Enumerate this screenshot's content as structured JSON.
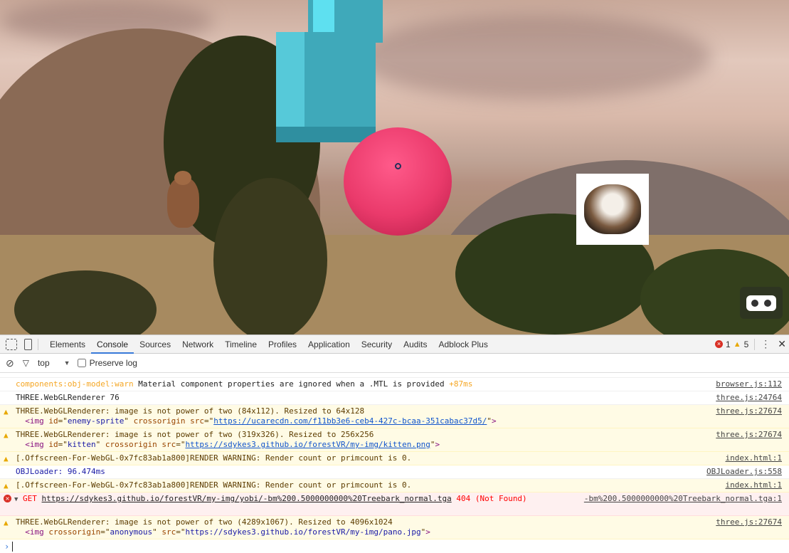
{
  "scene": {
    "vr_button": "vr-goggles-icon",
    "kitten_alt": "kitten",
    "enemy_alt": "enemy-sprite"
  },
  "devtools": {
    "tabs": [
      "Elements",
      "Console",
      "Sources",
      "Network",
      "Timeline",
      "Profiles",
      "Application",
      "Security",
      "Audits",
      "Adblock Plus"
    ],
    "active_tab": "Console",
    "error_count": "1",
    "warning_count": "5",
    "filter": {
      "context": "top",
      "preserve_log_label": "Preserve log",
      "preserve_log_checked": false
    }
  },
  "console": [
    {
      "level": "log",
      "parts": {
        "a": "components:obj-model:warn",
        "b": " Material component properties are ignored when a .MTL is provided ",
        "c": "+87ms"
      },
      "source": "browser.js:112"
    },
    {
      "level": "log",
      "text": "THREE.WebGLRenderer 76",
      "source": "three.js:24764"
    },
    {
      "level": "warn",
      "text": "THREE.WebGLRenderer: image is not power of two (84x112). Resized to 64x128",
      "img_id": "enemy-sprite",
      "img_src": "https://ucarecdn.com/f11bb3e6-ceb4-427c-bcaa-351cabac37d5/",
      "source": "three.js:27674"
    },
    {
      "level": "warn",
      "text": "THREE.WebGLRenderer: image is not power of two (319x326). Resized to 256x256",
      "img_id": "kitten",
      "img_src": "https://sdykes3.github.io/forestVR/my-img/kitten.png",
      "source": "three.js:27674"
    },
    {
      "level": "warn",
      "text": "[.Offscreen-For-WebGL-0x7fc83ab1a800]RENDER WARNING: Render count or primcount is 0.",
      "source": "index.html:1"
    },
    {
      "level": "info",
      "text": "OBJLoader: 96.474ms",
      "source": "OBJLoader.js:558"
    },
    {
      "level": "warn",
      "text": "[.Offscreen-For-WebGL-0x7fc83ab1a800]RENDER WARNING: Render count or primcount is 0.",
      "source": "index.html:1"
    },
    {
      "level": "error",
      "method": "GET",
      "url": "https://sdykes3.github.io/forestVR/my-img/yobi/-bm%200.5000000000%20Treebark_normal.tga",
      "status": "404 (Not Found)",
      "source": "-bm%200.5000000000%20Treebark_normal.tga:1"
    },
    {
      "level": "warn",
      "text": "THREE.WebGLRenderer: image is not power of two (4289x1067). Resized to 4096x1024",
      "img_crossorigin": "anonymous",
      "img_src": "https://sdykes3.github.io/forestVR/my-img/pano.jpg",
      "source": "three.js:27674"
    }
  ]
}
